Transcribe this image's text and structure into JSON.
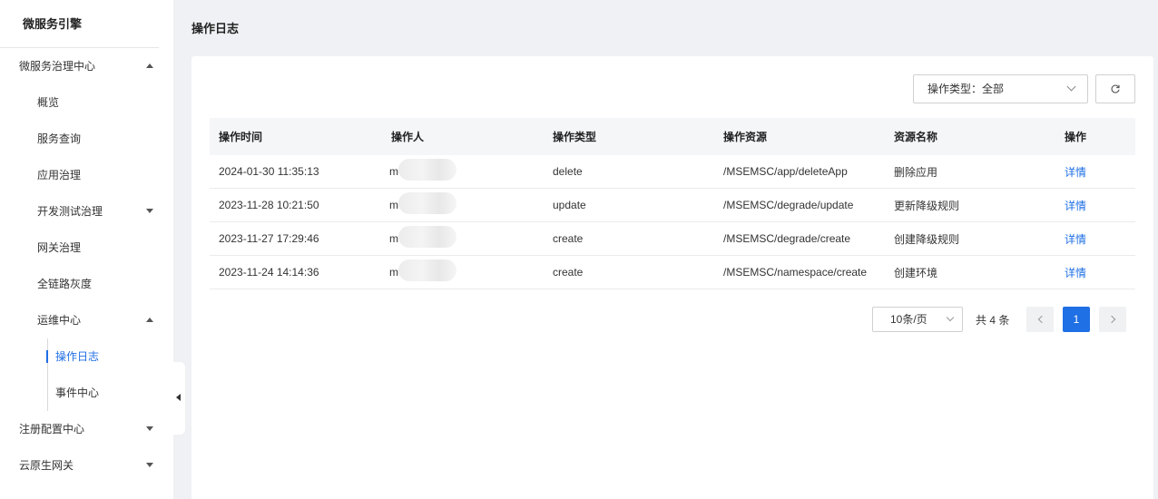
{
  "sidebar": {
    "brand": "微服务引擎",
    "groups": [
      {
        "label": "微服务治理中心"
      },
      {
        "label": "注册配置中心"
      },
      {
        "label": "云原生网关"
      }
    ],
    "items": [
      {
        "label": "概览"
      },
      {
        "label": "服务查询"
      },
      {
        "label": "应用治理"
      },
      {
        "label": "开发测试治理"
      },
      {
        "label": "网关治理"
      },
      {
        "label": "全链路灰度"
      },
      {
        "label": "运维中心"
      }
    ],
    "sub_items": [
      {
        "label": "操作日志",
        "active": true
      },
      {
        "label": "事件中心"
      }
    ]
  },
  "page": {
    "title": "操作日志"
  },
  "filter": {
    "label": "操作类型：全部"
  },
  "table": {
    "headers": [
      "操作时间",
      "操作人",
      "操作类型",
      "操作资源",
      "资源名称",
      "操作"
    ],
    "rows": [
      {
        "time": "2024-01-30 11:35:13",
        "operator": "m",
        "type": "delete",
        "resource": "/MSEMSC/app/deleteApp",
        "name": "删除应用",
        "action": "详情"
      },
      {
        "time": "2023-11-28 10:21:50",
        "operator": "m",
        "type": "update",
        "resource": "/MSEMSC/degrade/update",
        "name": "更新降级规则",
        "action": "详情"
      },
      {
        "time": "2023-11-27 17:29:46",
        "operator": "m",
        "type": "create",
        "resource": "/MSEMSC/degrade/create",
        "name": "创建降级规则",
        "action": "详情"
      },
      {
        "time": "2023-11-24 14:14:36",
        "operator": "m",
        "type": "create",
        "resource": "/MSEMSC/namespace/create",
        "name": "创建环境",
        "action": "详情"
      }
    ]
  },
  "pagination": {
    "page_size": "10条/页",
    "total": "共 4 条",
    "current": "1"
  },
  "colors": {
    "accent": "#1f6fe5"
  }
}
